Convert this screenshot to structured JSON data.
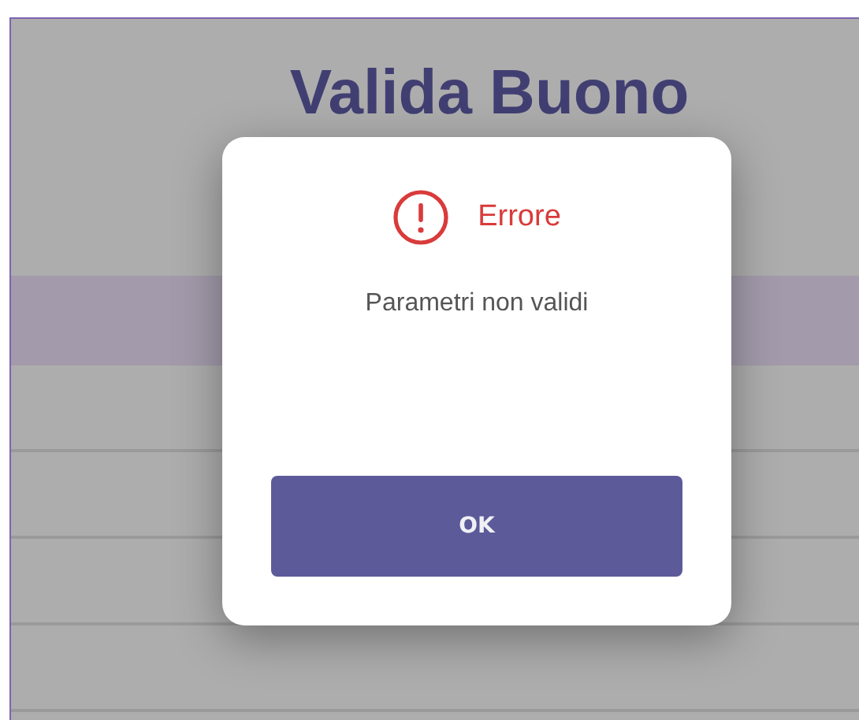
{
  "page": {
    "title": "Valida Buono"
  },
  "dialog": {
    "kind": "error",
    "title": "Errore",
    "message": "Parametri non validi",
    "buttons": [
      "OK"
    ]
  }
}
